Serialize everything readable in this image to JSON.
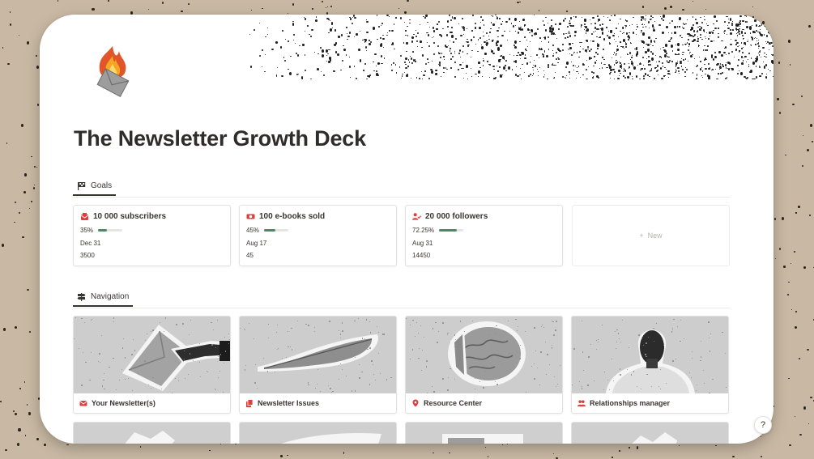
{
  "page": {
    "title": "The Newsletter Growth Deck",
    "icon": "flaming-envelope-icon"
  },
  "goals_section": {
    "tab_label": "Goals",
    "tab_icon": "checkered-flag-icon",
    "cards": [
      {
        "title": "10 000 subscribers",
        "icon": "mailbox-icon",
        "progress": "35%",
        "progress_value": 0.35,
        "date": "Dec 31",
        "value": "3500"
      },
      {
        "title": "100 e-books sold",
        "icon": "money-icon",
        "progress": "45%",
        "progress_value": 0.45,
        "date": "Aug 17",
        "value": "45"
      },
      {
        "title": "20 000 followers",
        "icon": "user-check-icon",
        "progress": "72.25%",
        "progress_value": 0.7225,
        "date": "Aug 31",
        "value": "14450"
      }
    ],
    "new_label": "New"
  },
  "navigation_section": {
    "tab_label": "Navigation",
    "tab_icon": "signpost-icon",
    "cards": [
      {
        "label": "Your Newsletter(s)",
        "icon": "envelope-icon",
        "image": "hand-holding-envelope"
      },
      {
        "label": "Newsletter Issues",
        "icon": "stacked-papers-icon",
        "image": "quill-feather"
      },
      {
        "label": "Resource Center",
        "icon": "map-pin-icon",
        "image": "brain"
      },
      {
        "label": "Relationships manager",
        "icon": "people-icon",
        "image": "person-back-view"
      }
    ]
  },
  "help": {
    "label": "?"
  },
  "colors": {
    "accent_red": "#e03e3e",
    "progress_green": "#4d8a64",
    "text": "#37352f",
    "background": "#c9b9a4"
  }
}
